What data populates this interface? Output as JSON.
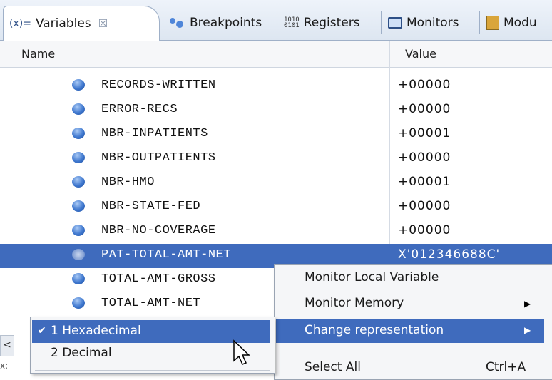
{
  "tabs": [
    {
      "icon": "(x)=",
      "label": "Variables",
      "close": "☒"
    },
    {
      "label": "Breakpoints"
    },
    {
      "icon": "1010\n0101",
      "label": "Registers"
    },
    {
      "label": "Monitors"
    },
    {
      "label": "Modu"
    }
  ],
  "columns": {
    "name": "Name",
    "value": "Value"
  },
  "rows": [
    {
      "name": "RECORDS-WRITTEN",
      "value": "+00000"
    },
    {
      "name": "ERROR-RECS",
      "value": "+00000"
    },
    {
      "name": "NBR-INPATIENTS",
      "value": "+00001"
    },
    {
      "name": "NBR-OUTPATIENTS",
      "value": "+00000"
    },
    {
      "name": "NBR-HMO",
      "value": "+00001"
    },
    {
      "name": "NBR-STATE-FED",
      "value": "+00000"
    },
    {
      "name": "NBR-NO-COVERAGE",
      "value": "+00000"
    },
    {
      "name": "PAT-TOTAL-AMT-NET",
      "value": "X'012346688C'"
    },
    {
      "name": "TOTAL-AMT-GROSS",
      "value": ""
    },
    {
      "name": "TOTAL-AMT-NET",
      "value": ""
    }
  ],
  "context_menu": {
    "items": [
      "Monitor Local Variable",
      "Monitor Memory",
      "Change representation"
    ],
    "select_all": {
      "label": "Select All",
      "shortcut": "Ctrl+A"
    }
  },
  "submenu": {
    "items": [
      {
        "label": "1 Hexadecimal",
        "checked": "✔"
      },
      {
        "label": "2 Decimal",
        "checked": ""
      }
    ]
  },
  "scroll_left": "<",
  "bottom_text": "x:",
  "colors": {
    "selection": "#3f6bbd",
    "accent": "#2d4f86"
  }
}
